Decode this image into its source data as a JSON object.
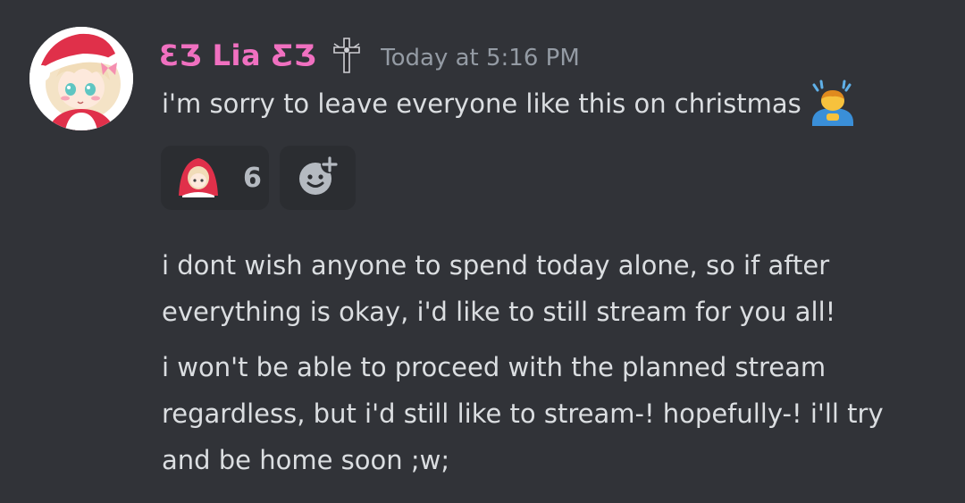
{
  "message": {
    "author": {
      "name": "ƐƷ Lia ƸƷ",
      "name_color": "#f070c0",
      "badge_icon": "cross-badge-icon",
      "avatar_icon": "anime-girl-santa-hat-avatar"
    },
    "timestamp": "Today at 5:16 PM",
    "first_line": "i'm sorry to leave everyone like this on christmas",
    "first_line_emoji": "person-bowing-emoji",
    "reactions": [
      {
        "icon": "girl-in-red-blanket-emoji",
        "count": "6"
      }
    ],
    "add_reaction_icon": "add-reaction-smiley-icon",
    "paragraph_2": [
      "i dont wish anyone to spend today alone, so if after",
      "everything is okay, i'd like to still stream for you all!"
    ],
    "paragraph_3": [
      "i won't be able to proceed with the planned stream",
      "regardless, but i'd still like to stream-! hopefully-! i'll try",
      "and be home soon ;w;"
    ]
  },
  "colors": {
    "background": "#313338",
    "text": "#dbdee1",
    "muted": "#949ba4",
    "reaction_bg": "#2b2d31"
  }
}
